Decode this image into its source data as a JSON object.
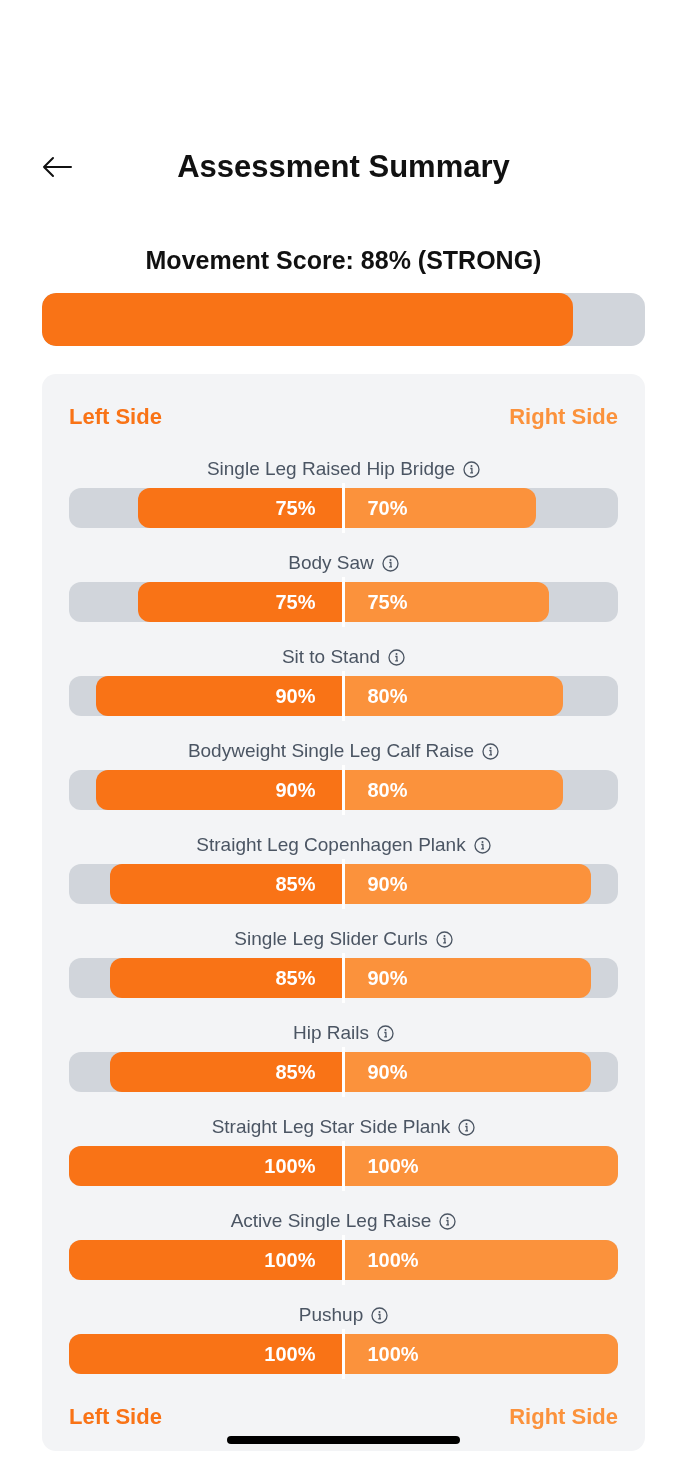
{
  "header": {
    "title": "Assessment Summary"
  },
  "movement_score": {
    "label": "Movement Score: 88% (STRONG)",
    "level": 0.88
  },
  "side_labels_top": {
    "left": "Left Side",
    "right": "Right Side"
  },
  "exercises": [
    {
      "name": "Single Leg Raised Hip Bridge",
      "left": {
        "value": "75%",
        "level": 0.75
      },
      "right": {
        "value": "70%",
        "level": 0.7
      }
    },
    {
      "name": "Body Saw",
      "left": {
        "value": "75%",
        "level": 0.75
      },
      "right": {
        "value": "75%",
        "level": 0.75
      }
    },
    {
      "name": "Sit to Stand",
      "left": {
        "value": "90%",
        "level": 0.9
      },
      "right": {
        "value": "80%",
        "level": 0.8
      }
    },
    {
      "name": "Bodyweight Single Leg Calf Raise",
      "left": {
        "value": "90%",
        "level": 0.9
      },
      "right": {
        "value": "80%",
        "level": 0.8
      }
    },
    {
      "name": "Straight Leg Copenhagen Plank",
      "left": {
        "value": "85%",
        "level": 0.85
      },
      "right": {
        "value": "90%",
        "level": 0.9
      }
    },
    {
      "name": "Single Leg Slider Curls",
      "left": {
        "value": "85%",
        "level": 0.85
      },
      "right": {
        "value": "90%",
        "level": 0.9
      }
    },
    {
      "name": "Hip Rails",
      "left": {
        "value": "85%",
        "level": 0.85
      },
      "right": {
        "value": "90%",
        "level": 0.9
      }
    },
    {
      "name": "Straight Leg Star Side Plank",
      "left": {
        "value": "100%",
        "level": 1
      },
      "right": {
        "value": "100%",
        "level": 1
      }
    },
    {
      "name": "Active Single Leg Raise",
      "left": {
        "value": "100%",
        "level": 1
      },
      "right": {
        "value": "100%",
        "level": 1
      }
    },
    {
      "name": "Pushup",
      "left": {
        "value": "100%",
        "level": 1
      },
      "right": {
        "value": "100%",
        "level": 1
      }
    }
  ],
  "side_labels_bottom": {
    "left": "Left Side",
    "right": "Right Side"
  }
}
